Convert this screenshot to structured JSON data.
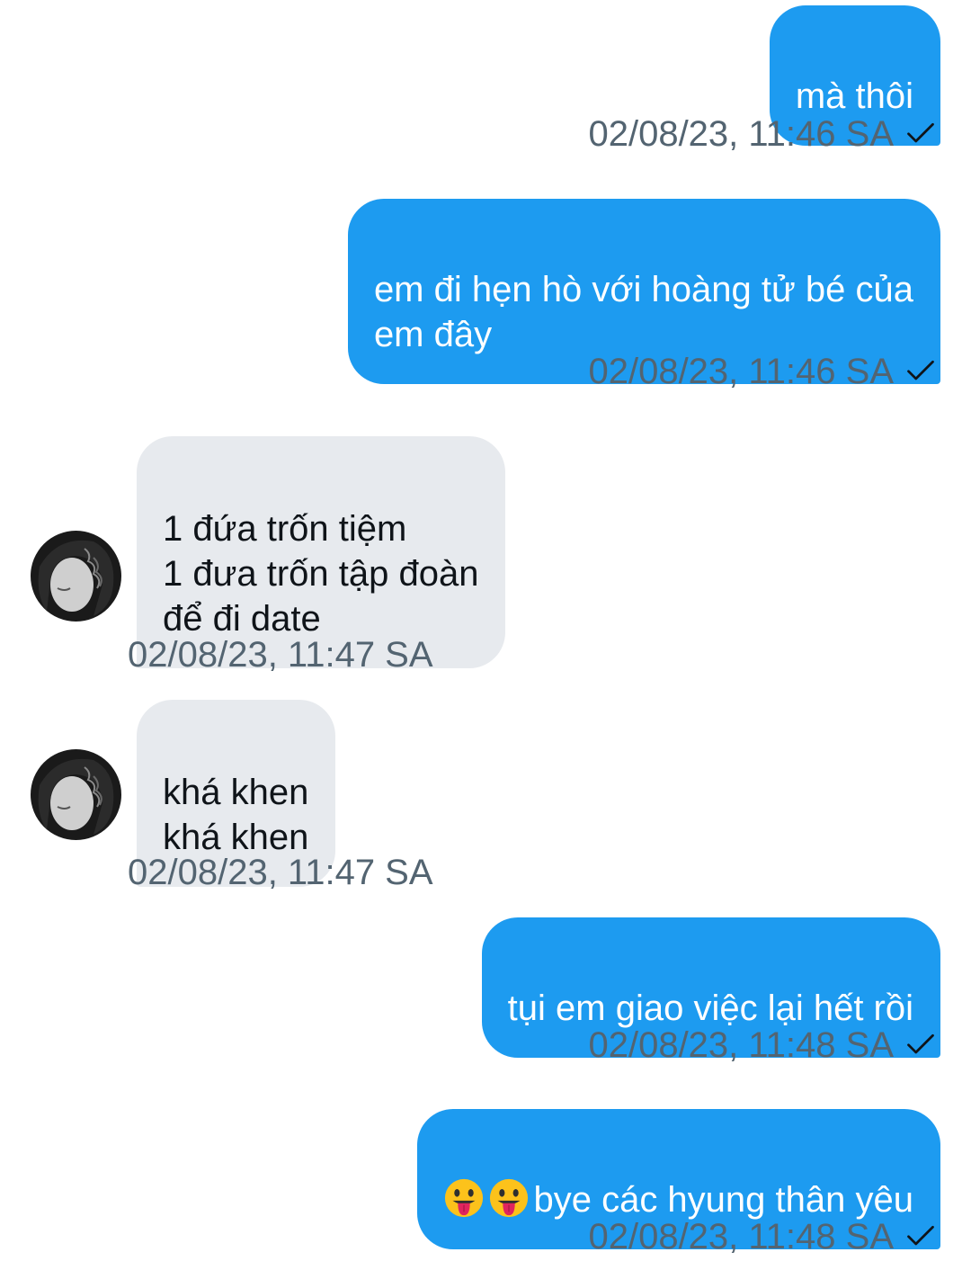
{
  "messages": [
    {
      "direction": "out",
      "text": "mà thôi",
      "timestamp": "02/08/23, 11:46 SA",
      "status": "sent"
    },
    {
      "direction": "out",
      "text": "em đi hẹn hò với hoàng tử bé của\nem đây",
      "timestamp": "02/08/23, 11:46 SA",
      "status": "sent"
    },
    {
      "direction": "in",
      "text": "1 đứa trốn tiệm\n1 đưa trốn tập đoàn\nđể đi date",
      "timestamp": "02/08/23, 11:47 SA"
    },
    {
      "direction": "in",
      "text": "khá khen\nkhá khen",
      "timestamp": "02/08/23, 11:47 SA"
    },
    {
      "direction": "out",
      "text": "tụi em giao việc lại hết rồi",
      "timestamp": "02/08/23, 11:48 SA",
      "status": "sent"
    },
    {
      "direction": "out",
      "emoji": [
        "face-with-tongue-icon",
        "face-with-tongue-icon"
      ],
      "text": "bye các hyung thân yêu",
      "timestamp": "02/08/23, 11:48 SA",
      "status": "sent"
    }
  ],
  "colors": {
    "outgoing_bubble": "#1d9bf0",
    "incoming_bubble": "#e7eaee",
    "timestamp": "#536471"
  }
}
